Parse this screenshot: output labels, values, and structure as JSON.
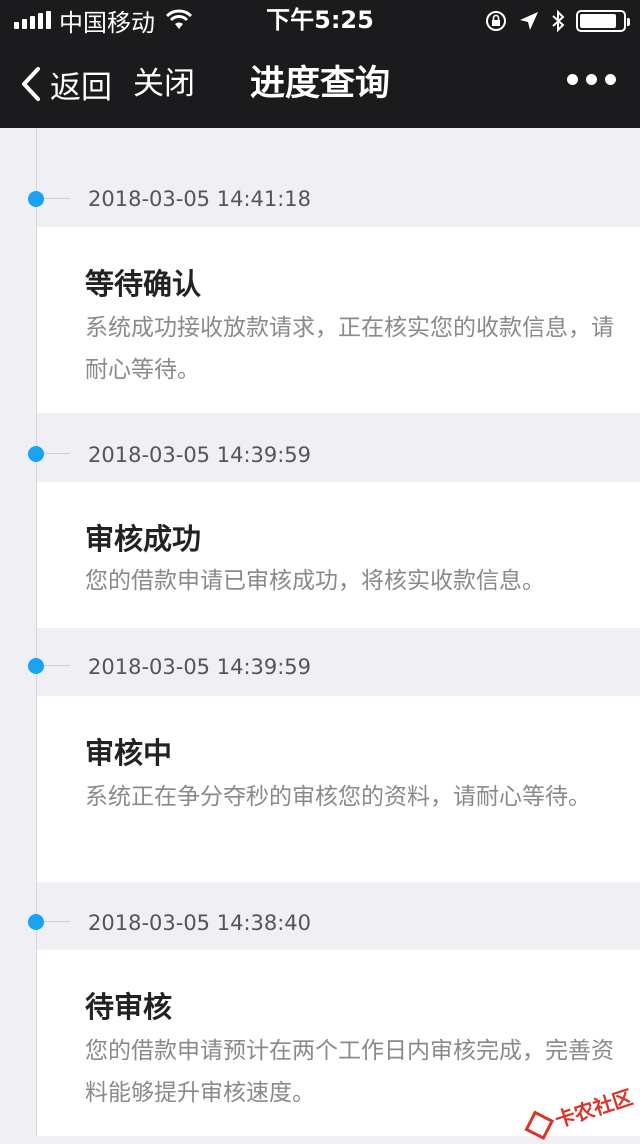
{
  "status_bar": {
    "carrier": "中国移动",
    "time": "下午5:25"
  },
  "nav": {
    "back_label": "返回",
    "close_label": "关闭",
    "title": "进度查询"
  },
  "timeline": [
    {
      "timestamp": "2018-03-05 14:41:18",
      "title": "等待确认",
      "description": "系统成功接收放款请求，正在核实您的收款信息，请耐心等待。"
    },
    {
      "timestamp": "2018-03-05 14:39:59",
      "title": "审核成功",
      "description": "您的借款申请已审核成功，将核实收款信息。"
    },
    {
      "timestamp": "2018-03-05 14:39:59",
      "title": "审核中",
      "description": "系统正在争分夺秒的审核您的资料，请耐心等待。"
    },
    {
      "timestamp": "2018-03-05 14:38:40",
      "title": "待审核",
      "description": "您的借款申请预计在两个工作日内审核完成，完善资料能够提升审核速度。"
    }
  ],
  "watermark": "卡农社区",
  "colors": {
    "accent": "#1aa3f2",
    "header_bg": "#1b1b1d",
    "page_bg": "#efeff4"
  },
  "battery_level": 0.85
}
